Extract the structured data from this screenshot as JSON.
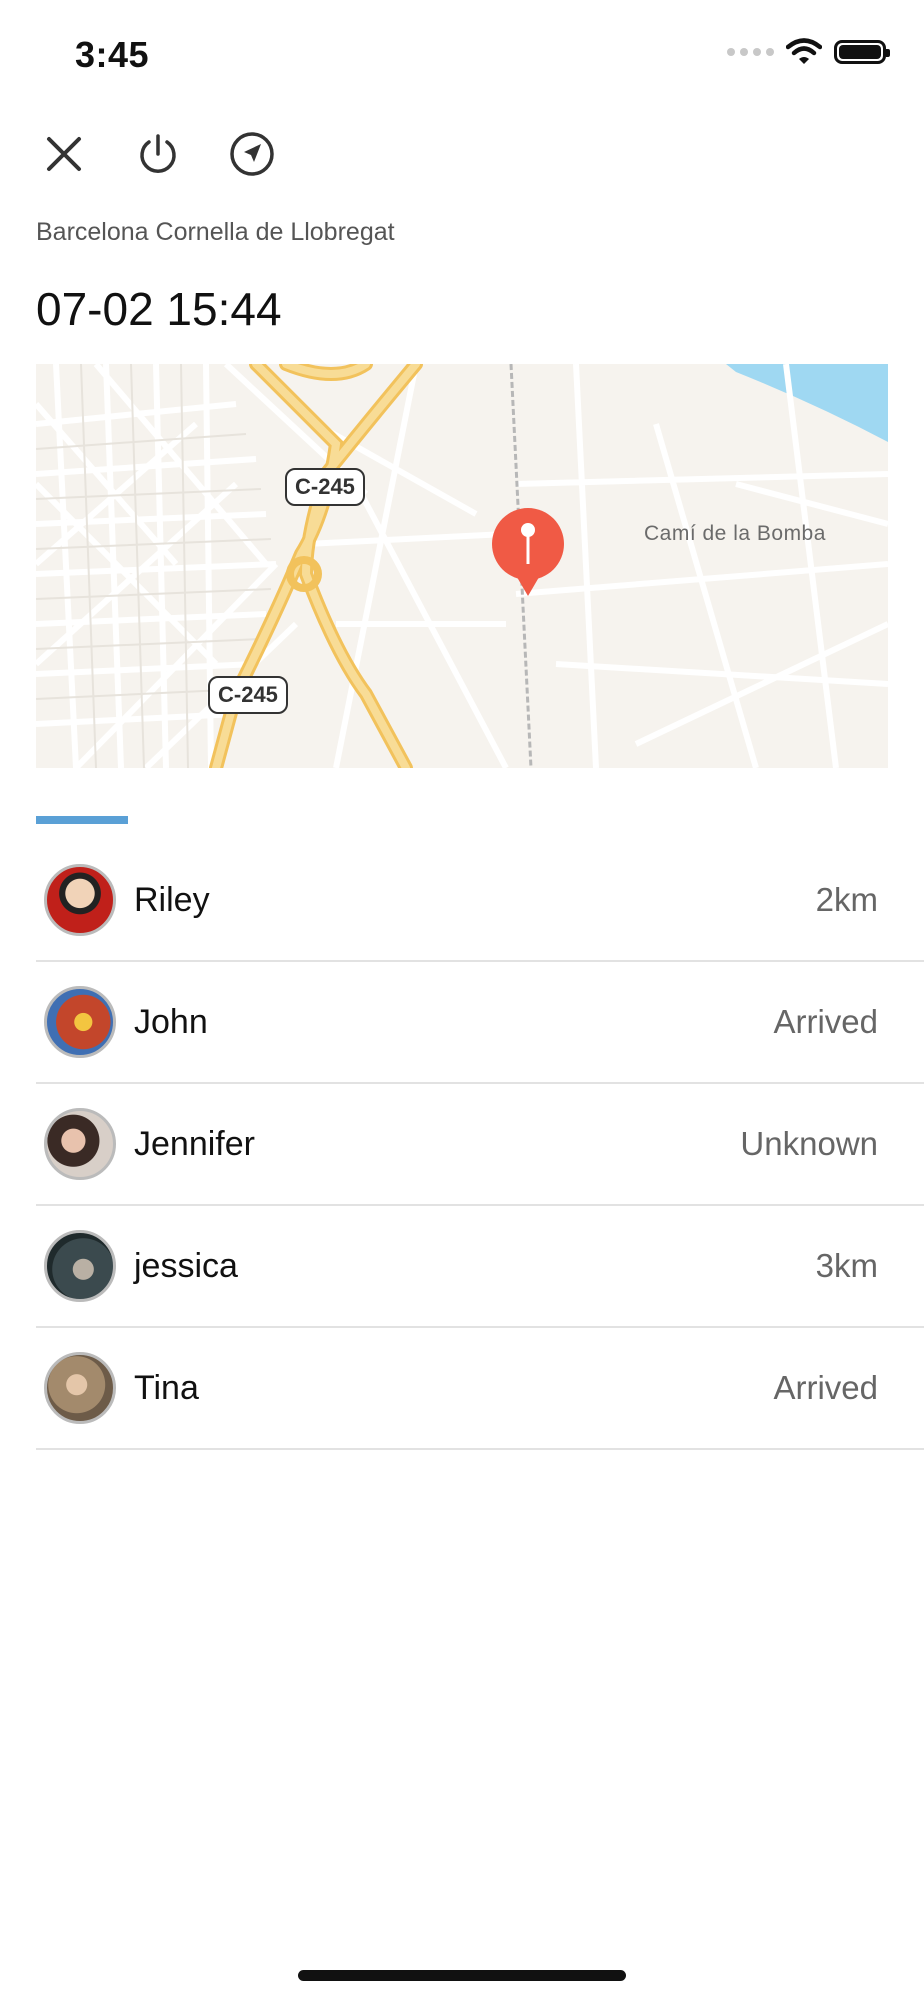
{
  "status_bar": {
    "time": "3:45"
  },
  "header": {
    "actions": [
      {
        "name": "close-icon"
      },
      {
        "name": "power-icon"
      },
      {
        "name": "navigation-icon"
      }
    ],
    "location": "Barcelona Cornella de Llobregat",
    "datetime": "07-02 15:44"
  },
  "map": {
    "road_labels": [
      "C-245",
      "C-245"
    ],
    "place_label": "Camí de la Bomba",
    "pin_icon": "location-pin-icon",
    "colors": {
      "land": "#f6f3ee",
      "water": "#9fd8f2",
      "highway": "#f7d88a",
      "pin": "#f05a45"
    }
  },
  "tabs": {
    "active_color": "#5aa0d6"
  },
  "members": [
    {
      "name": "Riley",
      "status": "2km",
      "avatar_color": "#c0201a"
    },
    {
      "name": "John",
      "status": "Arrived",
      "avatar_color": "#c3462b"
    },
    {
      "name": "Jennifer",
      "status": "Unknown",
      "avatar_color": "#6b5148"
    },
    {
      "name": "jessica",
      "status": "3km",
      "avatar_color": "#3b4a4e"
    },
    {
      "name": "Tina",
      "status": "Arrived",
      "avatar_color": "#a38a6c"
    }
  ]
}
